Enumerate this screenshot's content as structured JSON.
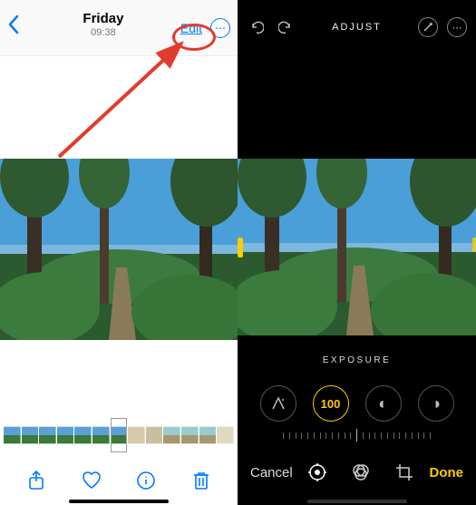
{
  "left": {
    "title_day": "Friday",
    "title_time": "09:38",
    "edit_label": "Edit",
    "more_glyph": "⋯",
    "toolbar_icons": [
      "share-icon",
      "heart-icon",
      "info-icon",
      "trash-icon"
    ]
  },
  "right": {
    "header_title": "ADJUST",
    "adjust_label": "EXPOSURE",
    "dial_value": "100",
    "cancel_label": "Cancel",
    "done_label": "Done"
  },
  "colors": {
    "ios_blue": "#007aff",
    "accent_yellow": "#ffcc00",
    "annotation_red": "#e23b2e"
  }
}
